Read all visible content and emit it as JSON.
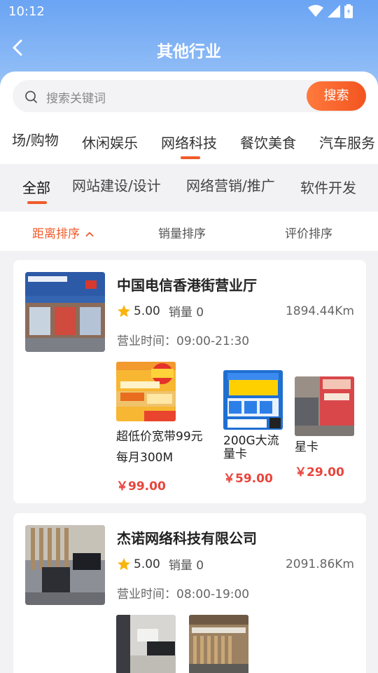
{
  "status": {
    "time": "10:12"
  },
  "header": {
    "title": "其他行业"
  },
  "search": {
    "placeholder": "搜索关键词",
    "button": "搜索"
  },
  "categories": [
    "场/购物",
    "休闲娱乐",
    "网络科技",
    "餐饮美食",
    "汽车服务"
  ],
  "categories_selected": "网络科技",
  "subcategories": [
    "全部",
    "网站建设/设计",
    "网络营销/推广",
    "软件开发"
  ],
  "subcategories_selected": "全部",
  "sort": {
    "distance": "距离排序",
    "sales": "销量排序",
    "rating": "评价排序",
    "active": "距离排序"
  },
  "stores": [
    {
      "name": "中国电信香港街营业厅",
      "rating": "5.00",
      "sales": "销量 0",
      "distance": "1894.44Km",
      "hours_label": "营业时间：",
      "hours": "09:00-21:30",
      "products": [
        {
          "name": "超低价宽带99元每月300M",
          "price": "￥99.00"
        },
        {
          "name": "200G大流量卡",
          "price": "￥59.00"
        },
        {
          "name": "星卡",
          "price": "￥29.00"
        }
      ],
      "colors": {
        "img_bg": "#3b6fbf"
      }
    },
    {
      "name": "杰诺网络科技有限公司",
      "rating": "5.00",
      "sales": "销量 0",
      "distance": "2091.86Km",
      "hours_label": "营业时间：",
      "hours": "08:00-19:00",
      "products": [],
      "colors": {
        "img_bg": "#6d6f7a"
      }
    }
  ],
  "theme": {
    "accent": "#f05a2a",
    "price": "#e8453c",
    "header": "#6aa4f3"
  }
}
